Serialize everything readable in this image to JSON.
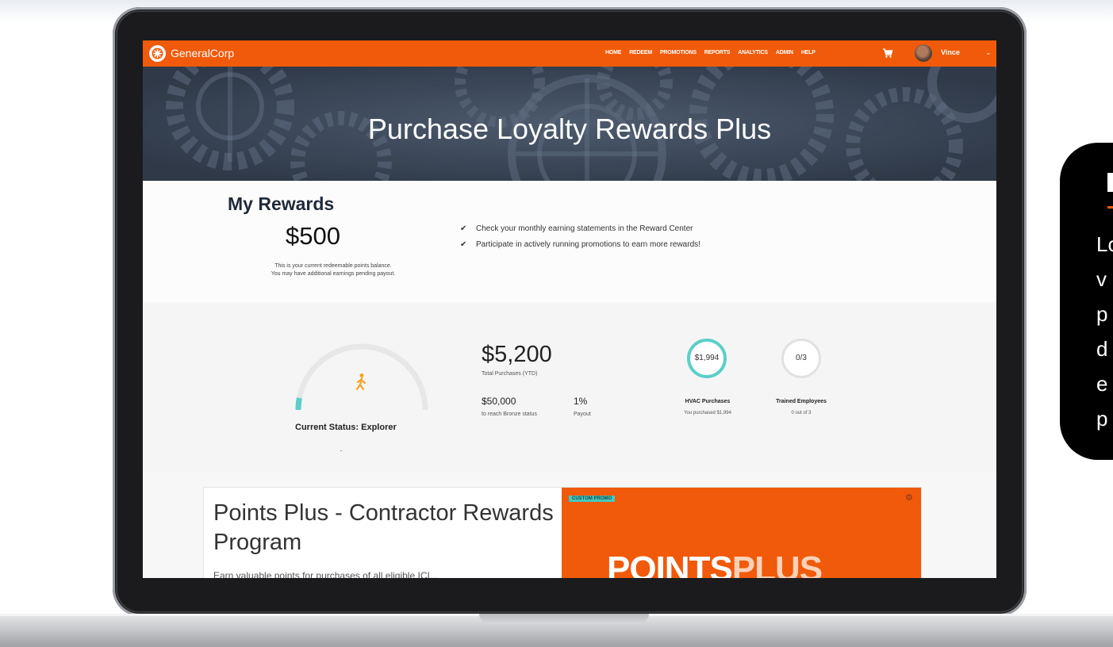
{
  "nav": {
    "brand": "GeneralCorp",
    "menu": [
      "HOME",
      "REDEEM",
      "PROMOTIONS",
      "REPORTS",
      "ANALYTICS",
      "ADMIN",
      "HELP"
    ],
    "user_name": "Vince"
  },
  "hero": {
    "title": "Purchase Loyalty Rewards Plus"
  },
  "rewards": {
    "heading": "My Rewards",
    "amount": "$500",
    "note_line1": "This is your current redeemable points balance.",
    "note_line2": "You may have additional earnings pending payout.",
    "bullets": [
      "Check your monthly earning statements in the Reward Center",
      "Participate in actively running promotions to earn more rewards!"
    ]
  },
  "stats": {
    "status_label": "Current Status: Explorer",
    "status_progress": 0.06,
    "total_purchases": "$5,200",
    "total_purchases_label": "Total Purchases (YTD)",
    "bronze_value": "$50,000",
    "bronze_label": "to reach Bronze status",
    "payout_value": "1%",
    "payout_label": "Payout",
    "hvac_value": "$1,994",
    "hvac_label": "HVAC Purchases",
    "hvac_sub": "You purchased $1,994",
    "trained_value": "0/3",
    "trained_label": "Trained Employees",
    "trained_sub": "0 out of 3"
  },
  "promo": {
    "title": "Points Plus - Contractor Rewards Program",
    "subtitle": "Earn valuable points for purchases of all eligible ICI...",
    "tag": "CUSTOM PROMO",
    "logo_text": "POINTS",
    "logo_text_plus": "PLUS"
  },
  "colors": {
    "brand": "#f05a0a",
    "accent": "#5bcfc8",
    "hero": "#364152"
  },
  "side_panel": {
    "text_lines": [
      "Lo",
      "v",
      "p",
      "d",
      "e",
      "p"
    ]
  }
}
